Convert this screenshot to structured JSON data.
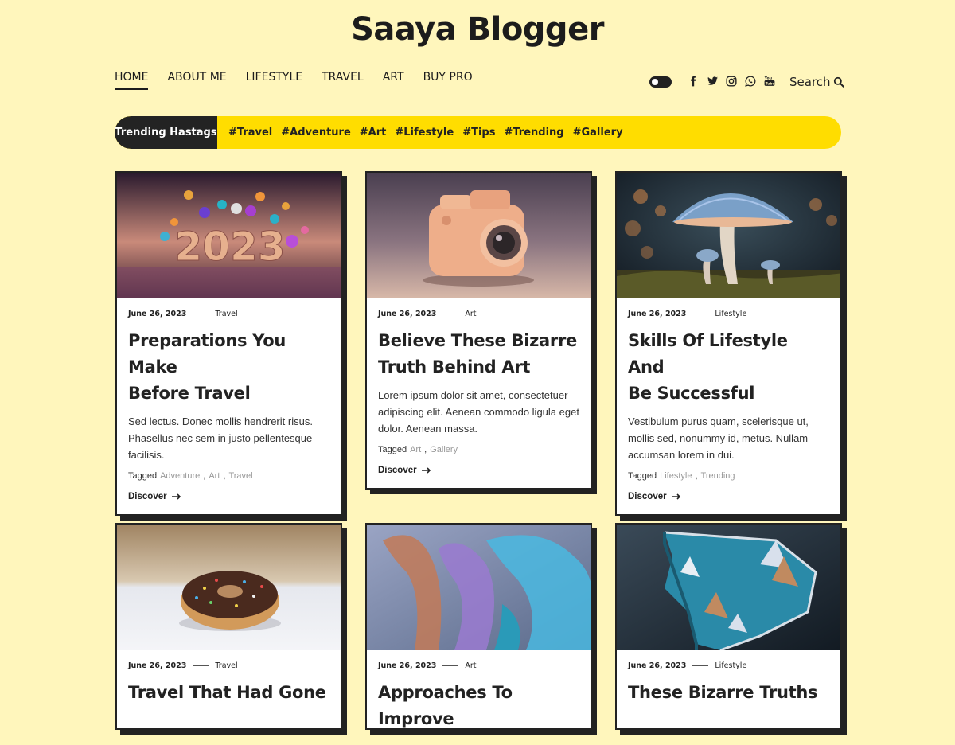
{
  "site": {
    "title": "Saaya Blogger"
  },
  "nav": {
    "items": [
      {
        "label": "HOME"
      },
      {
        "label": "ABOUT ME"
      },
      {
        "label": "LIFESTYLE"
      },
      {
        "label": "TRAVEL"
      },
      {
        "label": "ART"
      },
      {
        "label": "BUY PRO"
      }
    ]
  },
  "header": {
    "search_label": "Search"
  },
  "socials": [
    "facebook-icon",
    "twitter-icon",
    "instagram-icon",
    "whatsapp-icon",
    "youtube-icon"
  ],
  "trending": {
    "label": "Trending Hastags",
    "tags": [
      "#Travel",
      "#Adventure",
      "#Art",
      "#Lifestyle",
      "#Tips",
      "#Trending",
      "#Gallery"
    ]
  },
  "posts": [
    {
      "date": "June 26, 2023",
      "category": "Travel",
      "title_line1": "Preparations You Make",
      "title_line2": "Before Travel",
      "excerpt": "Sed lectus. Donec mollis hendrerit risus. Phasellus nec sem in justo pellentesque facilisis.",
      "tagged_label": "Tagged",
      "tags": [
        "Adventure",
        "Art",
        "Travel"
      ],
      "discover": "Discover"
    },
    {
      "date": "June 26, 2023",
      "category": "Art",
      "title_line1": "Believe These Bizarre",
      "title_line2": "Truth Behind Art",
      "excerpt": "Lorem ipsum dolor sit amet, consectetuer adipiscing elit. Aenean commodo ligula eget dolor. Aenean massa.",
      "tagged_label": "Tagged",
      "tags": [
        "Art",
        "Gallery"
      ],
      "discover": "Discover"
    },
    {
      "date": "June 26, 2023",
      "category": "Lifestyle",
      "title_line1": "Skills Of Lifestyle And",
      "title_line2": "Be Successful",
      "excerpt": "Vestibulum purus quam, scelerisque ut, mollis sed, nonummy id, metus. Nullam accumsan lorem in dui.",
      "tagged_label": "Tagged",
      "tags": [
        "Lifestyle",
        "Trending"
      ],
      "discover": "Discover"
    },
    {
      "date": "June 26, 2023",
      "category": "Travel",
      "title_line1": "Travel That Had Gone"
    },
    {
      "date": "June 26, 2023",
      "category": "Art",
      "title_line1": "Approaches To Improve"
    },
    {
      "date": "June 26, 2023",
      "category": "Lifestyle",
      "title_line1": "These Bizarre Truths"
    }
  ]
}
